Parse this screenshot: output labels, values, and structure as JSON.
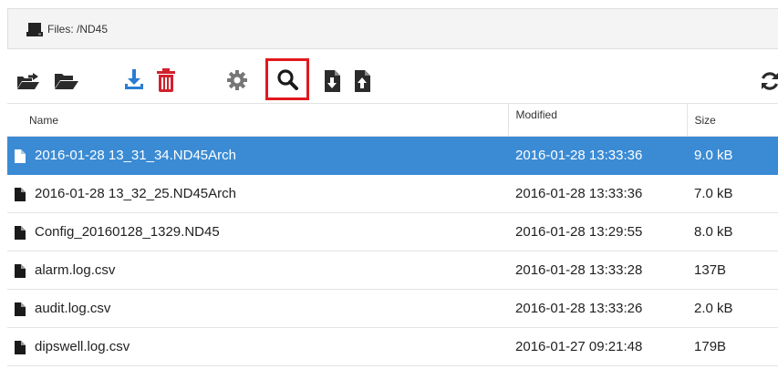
{
  "header": {
    "title": "Files: /ND45",
    "icon": "hard-drive-icon"
  },
  "toolbar": {
    "buttons": [
      {
        "name": "open-folder-up-button",
        "icon": "folder-open-arrow-icon"
      },
      {
        "name": "open-folder-button",
        "icon": "folder-open-icon"
      },
      {
        "name": "download-button",
        "icon": "download-icon"
      },
      {
        "name": "delete-button",
        "icon": "trash-icon"
      },
      {
        "name": "settings-button",
        "icon": "gear-icon"
      },
      {
        "name": "search-button",
        "icon": "search-icon"
      },
      {
        "name": "import-file-button",
        "icon": "file-import-icon"
      },
      {
        "name": "export-file-button",
        "icon": "file-export-icon"
      },
      {
        "name": "refresh-button",
        "icon": "refresh-icon"
      }
    ],
    "colors": {
      "icon": "#2b2b2b",
      "download": "#2a7dd1",
      "delete": "#d0222d",
      "settings": "#777777",
      "highlight": "#e2191e"
    }
  },
  "table": {
    "columns": [
      "Name",
      "Modified",
      "Size"
    ],
    "rows": [
      {
        "name": "2016-01-28 13_31_34.ND45Arch",
        "modified": "2016-01-28 13:33:36",
        "size": "9.0 kB",
        "selected": true
      },
      {
        "name": "2016-01-28 13_32_25.ND45Arch",
        "modified": "2016-01-28 13:33:36",
        "size": "7.0 kB"
      },
      {
        "name": "Config_20160128_1329.ND45",
        "modified": "2016-01-28 13:29:55",
        "size": "8.0 kB"
      },
      {
        "name": "alarm.log.csv",
        "modified": "2016-01-28 13:33:28",
        "size": "137B"
      },
      {
        "name": "audit.log.csv",
        "modified": "2016-01-28 13:33:26",
        "size": "2.0 kB"
      },
      {
        "name": "dipswell.log.csv",
        "modified": "2016-01-27 09:21:48",
        "size": "179B"
      }
    ],
    "selected_color": "#3a8bd4"
  }
}
